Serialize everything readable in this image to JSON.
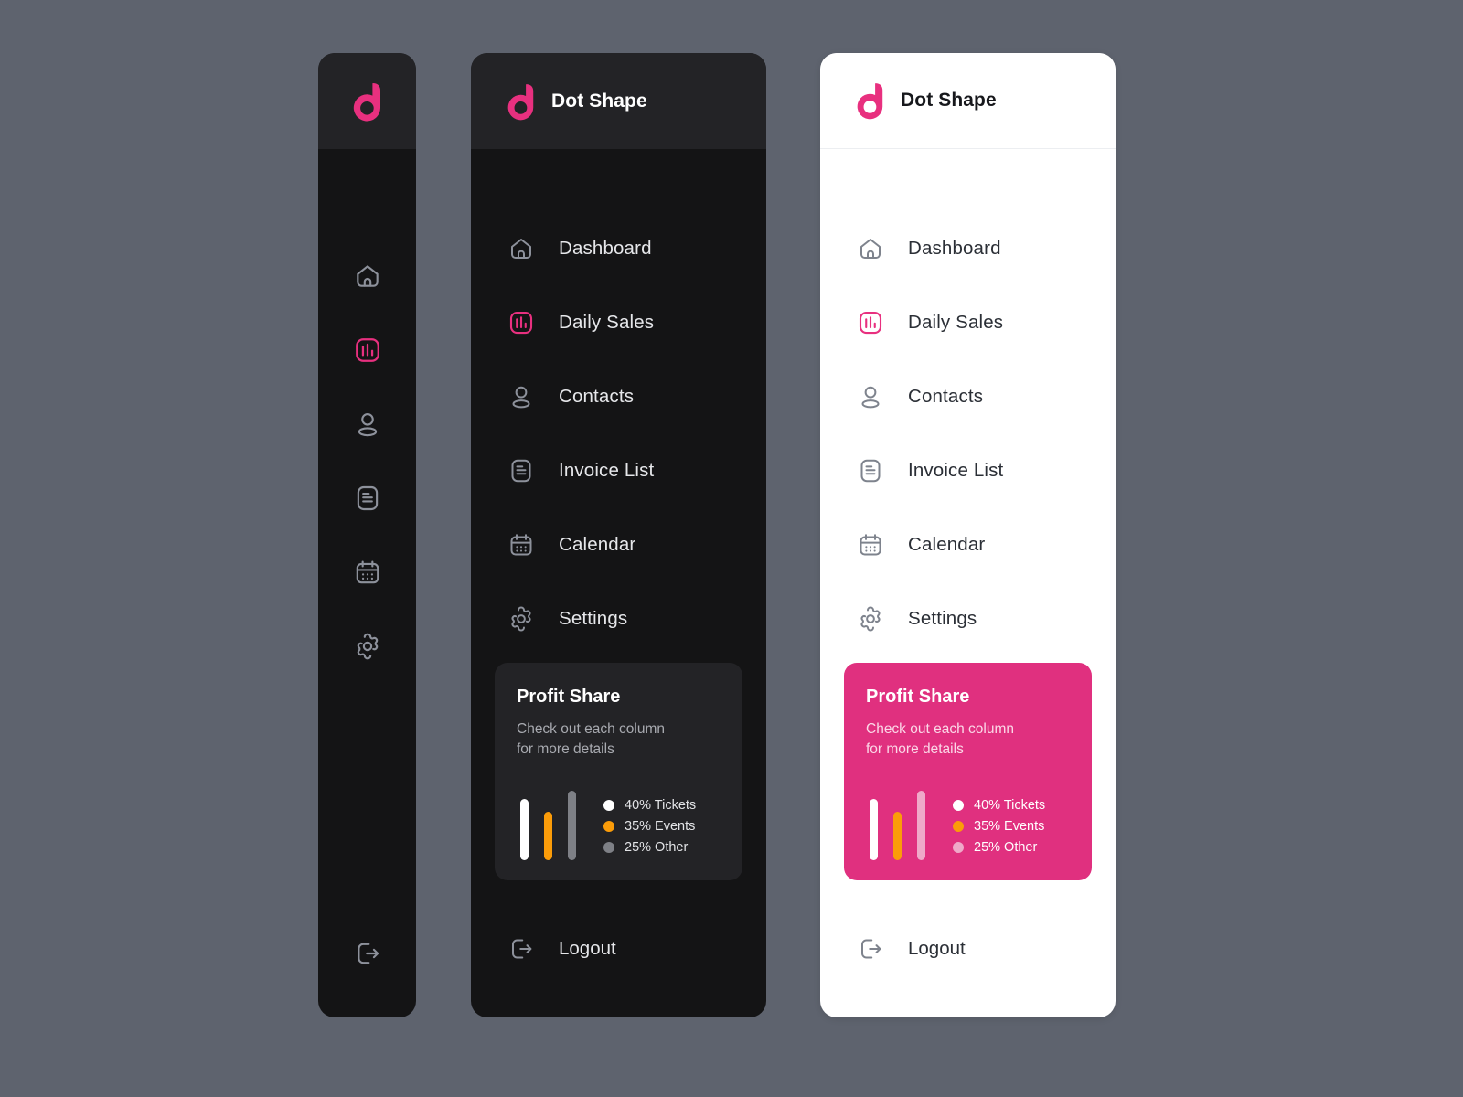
{
  "brand": {
    "name": "Dot Shape",
    "logo_icon": "dot-shape-logo-icon",
    "accent": "#e8307f"
  },
  "theme": {
    "page_background": "#5e636e",
    "dark_panel_bg": "#141415",
    "dark_header_bg": "#232326",
    "light_panel_bg": "#ffffff",
    "accent_pink": "#e0307f",
    "icon_muted": "#8d919b",
    "orange": "#fb9c09",
    "white": "#ffffff",
    "gray_bar": "#7e8086",
    "pink_bar": "#efa9c9"
  },
  "nav": {
    "items": [
      {
        "label": "Dashboard",
        "icon": "home-icon",
        "active": false
      },
      {
        "label": "Daily Sales",
        "icon": "bar-chart-icon",
        "active": true
      },
      {
        "label": "Contacts",
        "icon": "person-icon",
        "active": false
      },
      {
        "label": "Invoice List",
        "icon": "document-icon",
        "active": false
      },
      {
        "label": "Calendar",
        "icon": "calendar-icon",
        "active": false
      },
      {
        "label": "Settings",
        "icon": "gear-icon",
        "active": false
      }
    ]
  },
  "profit_card": {
    "title": "Profit Share",
    "subtitle": "Check out each column\nfor more details",
    "subtitle_line1": "Check out each column",
    "subtitle_line2": "for more details",
    "legend": [
      {
        "label": "40% Tickets",
        "value": 40,
        "dark_color": "#ffffff",
        "pink_color": "#ffffff"
      },
      {
        "label": "35% Events",
        "value": 35,
        "dark_color": "#fb9c09",
        "pink_color": "#fb9c09"
      },
      {
        "label": "25% Other",
        "value": 25,
        "dark_color": "#7e8086",
        "pink_color": "#efa9c9"
      }
    ],
    "bars": [
      {
        "name": "Tickets",
        "height_pct": 88,
        "dark_color": "#ffffff",
        "pink_color": "#ffffff"
      },
      {
        "name": "Events",
        "height_pct": 70,
        "dark_color": "#fb9c09",
        "pink_color": "#fb9c09"
      },
      {
        "name": "Other",
        "height_pct": 100,
        "dark_color": "#7e8086",
        "pink_color": "#efa9c9"
      }
    ]
  },
  "logout": {
    "label": "Logout",
    "icon": "logout-icon"
  }
}
